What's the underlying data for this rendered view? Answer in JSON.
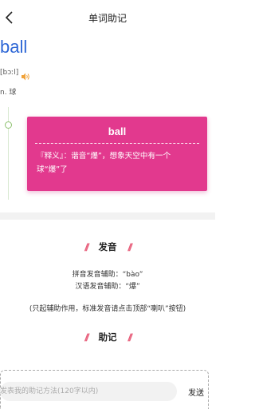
{
  "header": {
    "title": "单词助记",
    "back_icon": "chevron-left-icon"
  },
  "word": {
    "text": "ball",
    "phonetic": "[bɔːl]",
    "speaker_icon": "speaker-icon",
    "meaning": "n. 球"
  },
  "card": {
    "word": "ball",
    "explanation": "『释义』：谐音“爆”，想象天空中有一个球“爆”了",
    "color": "#e2398e"
  },
  "pronunciation": {
    "heading": "发音",
    "pinyin_line": "拼音发音辅助：“bào”",
    "hanzi_line": "汉语发音辅助：“爆”",
    "note": "(只起辅助作用，标准发音请点击顶部“喇叭”按钮)"
  },
  "mnemonic": {
    "heading": "助记"
  },
  "comment": {
    "placeholder": "发表我的助记方法(120字以内)",
    "send_label": "发送"
  },
  "colors": {
    "accent": "#e2398e",
    "word_blue": "#2e67d6",
    "slash_pink": "#e8607c",
    "timeline_green": "#8cc06d"
  }
}
